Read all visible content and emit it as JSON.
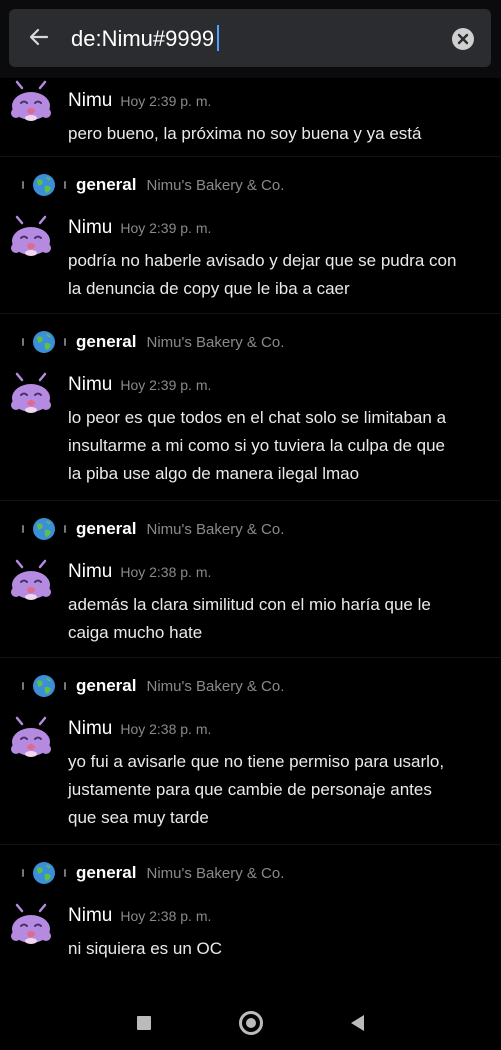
{
  "search": {
    "query": "de:Nimu#9999"
  },
  "results": [
    {
      "channel": null,
      "author": "Nimu",
      "time": "Hoy 2:39 p. m.",
      "lines": [
        "pero bueno, la próxima no soy buena y ya está"
      ]
    },
    {
      "channel": "general",
      "server": "Nimu's Bakery & Co.",
      "author": "Nimu",
      "time": "Hoy 2:39 p. m.",
      "lines": [
        "podría no haberle avisado y dejar que se pudra con",
        "la denuncia de copy que le iba a caer"
      ]
    },
    {
      "channel": "general",
      "server": "Nimu's Bakery & Co.",
      "author": "Nimu",
      "time": "Hoy 2:39 p. m.",
      "lines": [
        "lo peor es que todos en el chat solo se limitaban a",
        "insultarme a mi como si yo tuviera la culpa de que",
        "la piba use algo de manera ilegal lmao"
      ]
    },
    {
      "channel": "general",
      "server": "Nimu's Bakery & Co.",
      "author": "Nimu",
      "time": "Hoy 2:38 p. m.",
      "lines": [
        "además la clara similitud con el mio haría que le",
        "caiga mucho hate"
      ]
    },
    {
      "channel": "general",
      "server": "Nimu's Bakery & Co.",
      "author": "Nimu",
      "time": "Hoy 2:38 p. m.",
      "lines": [
        "yo fui a avisarle que no tiene permiso para usarlo,",
        "justamente para que cambie de personaje antes",
        "que sea muy tarde"
      ]
    },
    {
      "channel": "general",
      "server": "Nimu's Bakery & Co.",
      "author": "Nimu",
      "time": "Hoy 2:38 p. m.",
      "lines": [
        "ni siquiera es un OC"
      ]
    }
  ],
  "icons": {
    "back": "arrow-left-icon",
    "clear": "clear-circle-icon",
    "channel": "globe-icon",
    "avatar": "purple-creature-avatar",
    "nav": [
      "square-icon",
      "circle-icon",
      "triangle-back-icon"
    ]
  },
  "colors": {
    "background": "#000000",
    "search_box": "#2a2c30",
    "caret": "#4aa3ff",
    "avatar": "#b48be0"
  }
}
